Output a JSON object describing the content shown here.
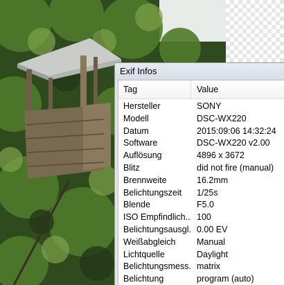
{
  "window": {
    "title": "Exif Infos"
  },
  "listview": {
    "columns": {
      "tag": "Tag",
      "value": "Value"
    },
    "rows": [
      {
        "tag": "Hersteller",
        "value": "SONY"
      },
      {
        "tag": "Modell",
        "value": "DSC-WX220"
      },
      {
        "tag": "Datum",
        "value": "2015:09:06 14:32:24"
      },
      {
        "tag": "Software",
        "value": "DSC-WX220 v2.00"
      },
      {
        "tag": "Auflösung",
        "value": "4896 x 3672"
      },
      {
        "tag": "Blitz",
        "value": "did not fire (manual)"
      },
      {
        "tag": "Brennweite",
        "value": "16.2mm"
      },
      {
        "tag": "Belichtungszeit",
        "value": "1/25s"
      },
      {
        "tag": "Blende",
        "value": "F5.0"
      },
      {
        "tag": "ISO Empfindlich...",
        "value": "100"
      },
      {
        "tag": "Belichtungsausgl...",
        "value": "0.00 EV"
      },
      {
        "tag": "Weißabgleich",
        "value": "Manual"
      },
      {
        "tag": "Lichtquelle",
        "value": "Daylight"
      },
      {
        "tag": "Belichtungsmess...",
        "value": "matrix"
      },
      {
        "tag": "Belichtung",
        "value": "program (auto)"
      }
    ]
  },
  "colors": {
    "foliage": "#3f5f25",
    "wood": "#7a6a52",
    "roof": "#c9ccc8",
    "window_frame": "#dfe4ea"
  }
}
